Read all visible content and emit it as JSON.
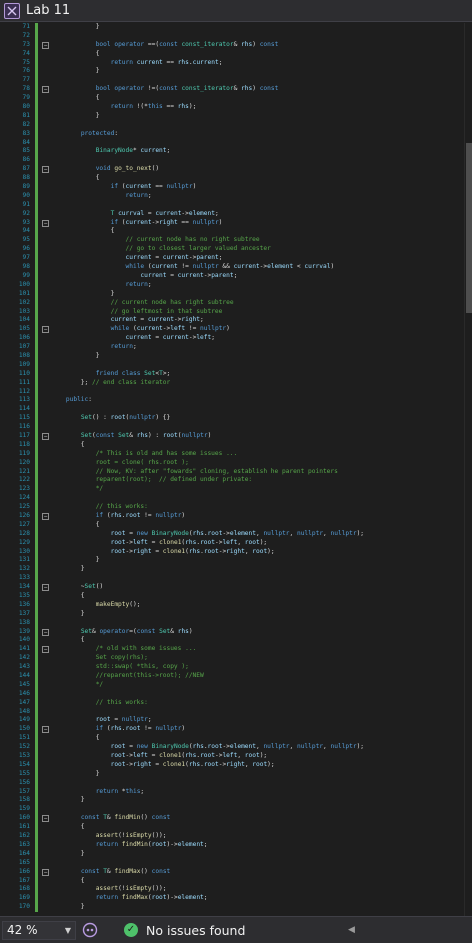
{
  "window": {
    "title": "Lab 11"
  },
  "colors": {
    "keyword": "#569cd6",
    "type": "#4ec9b0",
    "function": "#dcdcaa",
    "variable": "#9cdcfe",
    "comment": "#57a64a",
    "text": "#dcdcdc",
    "linenumber": "#2b91af",
    "change_margin": "#57a64a"
  },
  "editor": {
    "lines": [
      {
        "n": "71",
        "t": "            }"
      },
      {
        "n": "72",
        "t": ""
      },
      {
        "n": "73",
        "t": "            bool operator ==(const const_iterator& rhs) const"
      },
      {
        "n": "74",
        "t": "            {"
      },
      {
        "n": "75",
        "t": "                return current == rhs.current;"
      },
      {
        "n": "76",
        "t": "            }"
      },
      {
        "n": "77",
        "t": ""
      },
      {
        "n": "78",
        "t": "            bool operator !=(const const_iterator& rhs) const"
      },
      {
        "n": "79",
        "t": "            {"
      },
      {
        "n": "80",
        "t": "                return !(*this == rhs);"
      },
      {
        "n": "81",
        "t": "            }"
      },
      {
        "n": "82",
        "t": ""
      },
      {
        "n": "83",
        "t": "        protected:"
      },
      {
        "n": "84",
        "t": ""
      },
      {
        "n": "85",
        "t": "            BinaryNode* current;"
      },
      {
        "n": "86",
        "t": ""
      },
      {
        "n": "87",
        "t": "            void go_to_next()"
      },
      {
        "n": "88",
        "t": "            {"
      },
      {
        "n": "89",
        "t": "                if (current == nullptr)"
      },
      {
        "n": "90",
        "t": "                    return;"
      },
      {
        "n": "91",
        "t": ""
      },
      {
        "n": "92",
        "t": "                T currval = current->element;"
      },
      {
        "n": "93",
        "t": "                if (current->right == nullptr)"
      },
      {
        "n": "94",
        "t": "                {"
      },
      {
        "n": "95",
        "t": "                    // current node has no right subtree"
      },
      {
        "n": "96",
        "t": "                    // go to closest larger valued ancester"
      },
      {
        "n": "97",
        "t": "                    current = current->parent;"
      },
      {
        "n": "98",
        "t": "                    while (current != nullptr && current->element < currval)"
      },
      {
        "n": "99",
        "t": "                        current = current->parent;"
      },
      {
        "n": "100",
        "t": "                    return;"
      },
      {
        "n": "101",
        "t": "                }"
      },
      {
        "n": "102",
        "t": "                // current node has right subtree"
      },
      {
        "n": "103",
        "t": "                // go leftmost in that subtree"
      },
      {
        "n": "104",
        "t": "                current = current->right;"
      },
      {
        "n": "105",
        "t": "                while (current->left != nullptr)"
      },
      {
        "n": "106",
        "t": "                    current = current->left;"
      },
      {
        "n": "107",
        "t": "                return;"
      },
      {
        "n": "108",
        "t": "            }"
      },
      {
        "n": "109",
        "t": ""
      },
      {
        "n": "110",
        "t": "            friend class Set<T>;"
      },
      {
        "n": "111",
        "t": "        }; // end class iterator"
      },
      {
        "n": "112",
        "t": ""
      },
      {
        "n": "113",
        "t": "    public:"
      },
      {
        "n": "114",
        "t": ""
      },
      {
        "n": "115",
        "t": "        Set() : root(nullptr) {}"
      },
      {
        "n": "116",
        "t": ""
      },
      {
        "n": "117",
        "t": "        Set(const Set& rhs) : root(nullptr)"
      },
      {
        "n": "118",
        "t": "        {"
      },
      {
        "n": "119",
        "t": "            /* This is old and has some issues ..."
      },
      {
        "n": "120",
        "t": "            root = clone( rhs.root );"
      },
      {
        "n": "121",
        "t": "            // Now, KV: after \"fowards\" cloning, establish he parent pointers"
      },
      {
        "n": "122",
        "t": "            reparent(root);  // defined under private:"
      },
      {
        "n": "123",
        "t": "            */"
      },
      {
        "n": "124",
        "t": ""
      },
      {
        "n": "125",
        "t": "            // this works:"
      },
      {
        "n": "126",
        "t": "            if (rhs.root != nullptr)"
      },
      {
        "n": "127",
        "t": "            {"
      },
      {
        "n": "128",
        "t": "                root = new BinaryNode(rhs.root->element, nullptr, nullptr, nullptr);"
      },
      {
        "n": "129",
        "t": "                root->left = clone1(rhs.root->left, root);"
      },
      {
        "n": "130",
        "t": "                root->right = clone1(rhs.root->right, root);"
      },
      {
        "n": "131",
        "t": "            }"
      },
      {
        "n": "132",
        "t": "        }"
      },
      {
        "n": "133",
        "t": ""
      },
      {
        "n": "134",
        "t": "        ~Set()"
      },
      {
        "n": "135",
        "t": "        {"
      },
      {
        "n": "136",
        "t": "            makeEmpty();"
      },
      {
        "n": "137",
        "t": "        }"
      },
      {
        "n": "138",
        "t": ""
      },
      {
        "n": "139",
        "t": "        Set& operator=(const Set& rhs)"
      },
      {
        "n": "140",
        "t": "        {"
      },
      {
        "n": "141",
        "t": "            /* old with some issues ..."
      },
      {
        "n": "142",
        "t": "            Set copy(rhs);"
      },
      {
        "n": "143",
        "t": "            std::swap( *this, copy );"
      },
      {
        "n": "144",
        "t": "            //reparent(this->root); //NEW"
      },
      {
        "n": "145",
        "t": "            */"
      },
      {
        "n": "146",
        "t": ""
      },
      {
        "n": "147",
        "t": "            // this works:"
      },
      {
        "n": "148",
        "t": ""
      },
      {
        "n": "149",
        "t": "            root = nullptr;"
      },
      {
        "n": "150",
        "t": "            if (rhs.root != nullptr)"
      },
      {
        "n": "151",
        "t": "            {"
      },
      {
        "n": "152",
        "t": "                root = new BinaryNode(rhs.root->element, nullptr, nullptr, nullptr);"
      },
      {
        "n": "153",
        "t": "                root->left = clone1(rhs.root->left, root);"
      },
      {
        "n": "154",
        "t": "                root->right = clone1(rhs.root->right, root);"
      },
      {
        "n": "155",
        "t": "            }"
      },
      {
        "n": "156",
        "t": ""
      },
      {
        "n": "157",
        "t": "            return *this;"
      },
      {
        "n": "158",
        "t": "        }"
      },
      {
        "n": "159",
        "t": ""
      },
      {
        "n": "160",
        "t": "        const T& findMin() const"
      },
      {
        "n": "161",
        "t": "        {"
      },
      {
        "n": "162",
        "t": "            assert(!isEmpty());"
      },
      {
        "n": "163",
        "t": "            return findMin(root)->element;"
      },
      {
        "n": "164",
        "t": "        }"
      },
      {
        "n": "165",
        "t": ""
      },
      {
        "n": "166",
        "t": "        const T& findMax() const"
      },
      {
        "n": "167",
        "t": "        {"
      },
      {
        "n": "168",
        "t": "            assert(!isEmpty());"
      },
      {
        "n": "169",
        "t": "            return findMax(root)->element;"
      },
      {
        "n": "170",
        "t": "        }"
      }
    ]
  },
  "statusbar": {
    "zoom": "42 %",
    "issues": "No issues found"
  }
}
